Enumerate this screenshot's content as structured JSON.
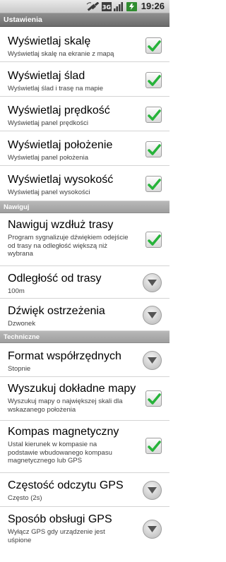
{
  "status_bar": {
    "time": "19:26",
    "icons": [
      "satellite-icon",
      "3g-icon",
      "signal-icon",
      "battery-charging-icon"
    ]
  },
  "title": "Ustawienia",
  "sections": {
    "general": {
      "items": [
        {
          "title": "Wyświetlaj skalę",
          "summary": "Wyświetlaj skalę na ekranie z mapą",
          "control": "checkbox",
          "checked": true
        },
        {
          "title": "Wyświetlaj ślad",
          "summary": "Wyświetlaj ślad i trasę na mapie",
          "control": "checkbox",
          "checked": true
        },
        {
          "title": "Wyświetlaj prędkość",
          "summary": "Wyświetlaj panel prędkości",
          "control": "checkbox",
          "checked": true
        },
        {
          "title": "Wyświetlaj położenie",
          "summary": "Wyświetlaj panel położenia",
          "control": "checkbox",
          "checked": true
        },
        {
          "title": "Wyświetlaj wysokość",
          "summary": "Wyświetlaj panel wysokości",
          "control": "checkbox",
          "checked": true
        }
      ]
    },
    "navigate": {
      "header": "Nawiguj",
      "items": [
        {
          "title": "Nawiguj wzdłuż trasy",
          "summary": "Program sygnalizuje dźwiękiem odejście od trasy na odległość większą niż wybrana",
          "control": "checkbox",
          "checked": true
        },
        {
          "title": "Odległość od trasy",
          "summary": "100m",
          "control": "dropdown"
        },
        {
          "title": "Dźwięk ostrzeżenia",
          "summary": "Dzwonek",
          "control": "dropdown"
        }
      ]
    },
    "technical": {
      "header": "Techniczne",
      "items": [
        {
          "title": "Format współrzędnych",
          "summary": "Stopnie",
          "control": "dropdown"
        },
        {
          "title": "Wyszukuj dokładne mapy",
          "summary": "Wyszukuj mapy o największej skali dla wskazanego położenia",
          "control": "checkbox",
          "checked": true
        },
        {
          "title": "Kompas magnetyczny",
          "summary": "Ustal kierunek w kompasie na podstawie wbudowanego kompasu magnetycznego lub GPS",
          "control": "checkbox",
          "checked": true
        },
        {
          "title": "Częstość odczytu GPS",
          "summary": "Często (2s)",
          "control": "dropdown"
        },
        {
          "title": "Sposób obsługi GPS",
          "summary": "Wyłącz GPS gdy urządzenie jest uśpione",
          "control": "dropdown"
        }
      ]
    }
  },
  "colors": {
    "check_green": "#27b33a",
    "title_bar": "#7a7a7a",
    "category_bar": "#a9a9a9"
  }
}
